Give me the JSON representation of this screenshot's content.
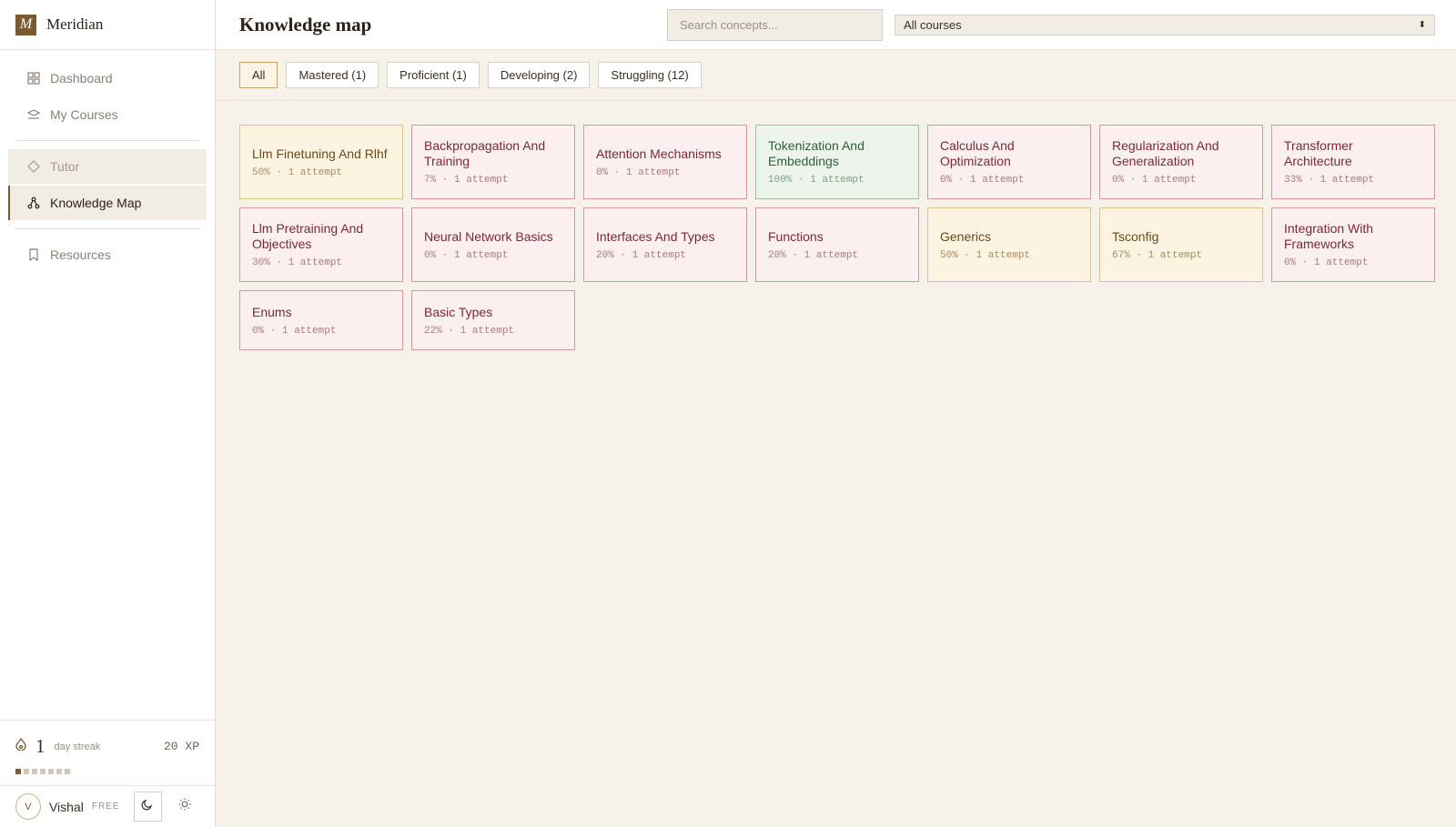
{
  "brand": {
    "logo": "M",
    "name": "Meridian"
  },
  "nav": {
    "dashboard": "Dashboard",
    "my_courses": "My Courses",
    "tutor": "Tutor",
    "knowledge_map": "Knowledge Map",
    "resources": "Resources"
  },
  "streak": {
    "count": "1",
    "label": "day streak",
    "xp": "20 XP",
    "days_total": 7,
    "days_done": 1
  },
  "user": {
    "initial": "V",
    "name": "Vishal",
    "plan": "FREE"
  },
  "header": {
    "title": "Knowledge map",
    "search_placeholder": "Search concepts...",
    "course_filter": "All courses"
  },
  "filters": [
    "All",
    "Mastered (1)",
    "Proficient (1)",
    "Developing (2)",
    "Struggling (12)"
  ],
  "concepts": [
    {
      "name": "Llm Finetuning And Rlhf",
      "meta": "50% · 1 attempt",
      "status": "developing"
    },
    {
      "name": "Backpropagation And Training",
      "meta": "7% · 1 attempt",
      "status": "struggling"
    },
    {
      "name": "Attention Mechanisms",
      "meta": "0% · 1 attempt",
      "status": "struggling"
    },
    {
      "name": "Tokenization And Embeddings",
      "meta": "100% · 1 attempt",
      "status": "mastered"
    },
    {
      "name": "Calculus And Optimization",
      "meta": "0% · 1 attempt",
      "status": "struggling"
    },
    {
      "name": "Regularization And Generalization",
      "meta": "0% · 1 attempt",
      "status": "struggling"
    },
    {
      "name": "Transformer Architecture",
      "meta": "33% · 1 attempt",
      "status": "struggling"
    },
    {
      "name": "Llm Pretraining And Objectives",
      "meta": "30% · 1 attempt",
      "status": "struggling"
    },
    {
      "name": "Neural Network Basics",
      "meta": "0% · 1 attempt",
      "status": "struggling"
    },
    {
      "name": "Interfaces And Types",
      "meta": "20% · 1 attempt",
      "status": "struggling"
    },
    {
      "name": "Functions",
      "meta": "20% · 1 attempt",
      "status": "struggling"
    },
    {
      "name": "Generics",
      "meta": "50% · 1 attempt",
      "status": "developing"
    },
    {
      "name": "Tsconfig",
      "meta": "67% · 1 attempt",
      "status": "developing"
    },
    {
      "name": "Integration With Frameworks",
      "meta": "0% · 1 attempt",
      "status": "struggling"
    },
    {
      "name": "Enums",
      "meta": "0% · 1 attempt",
      "status": "struggling"
    },
    {
      "name": "Basic Types",
      "meta": "22% · 1 attempt",
      "status": "struggling"
    }
  ]
}
